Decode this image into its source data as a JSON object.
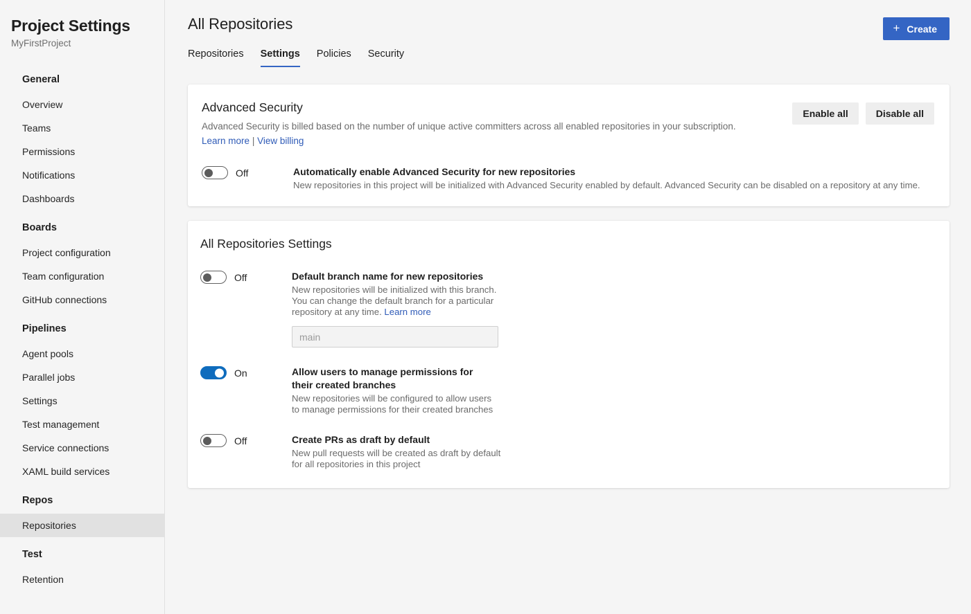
{
  "sidebar": {
    "title": "Project Settings",
    "subtitle": "MyFirstProject",
    "groups": [
      {
        "label": "General",
        "items": [
          "Overview",
          "Teams",
          "Permissions",
          "Notifications",
          "Dashboards"
        ]
      },
      {
        "label": "Boards",
        "items": [
          "Project configuration",
          "Team configuration",
          "GitHub connections"
        ]
      },
      {
        "label": "Pipelines",
        "items": [
          "Agent pools",
          "Parallel jobs",
          "Settings",
          "Test management",
          "Service connections",
          "XAML build services"
        ]
      },
      {
        "label": "Repos",
        "items": [
          "Repositories"
        ]
      },
      {
        "label": "Test",
        "items": [
          "Retention"
        ]
      }
    ],
    "selected_item": "Repositories"
  },
  "header": {
    "title": "All Repositories",
    "create_button": {
      "label": "Create",
      "icon": "plus-icon"
    },
    "tabs": [
      {
        "label": "Repositories",
        "active": false
      },
      {
        "label": "Settings",
        "active": true
      },
      {
        "label": "Policies",
        "active": false
      },
      {
        "label": "Security",
        "active": false
      }
    ]
  },
  "advanced_security": {
    "heading": "Advanced Security",
    "description": "Advanced Security is billed based on the number of unique active committers across all enabled repositories in your subscription.",
    "link_learn_more": "Learn more",
    "link_separator": "|",
    "link_view_billing": "View billing",
    "enable_all_label": "Enable all",
    "disable_all_label": "Disable all",
    "setting": {
      "toggle_state": "Off",
      "toggle_on": false,
      "title": "Automatically enable Advanced Security for new repositories",
      "description": "New repositories in this project will be initialized with Advanced Security enabled by default. Advanced Security can be disabled on a repository at any time."
    }
  },
  "all_repositories_settings": {
    "heading": "All Repositories Settings",
    "settings": [
      {
        "toggle_state": "Off",
        "toggle_on": false,
        "title": "Default branch name for new repositories",
        "description": "New repositories will be initialized with this branch. You can change the default branch for a particular repository at any time.",
        "inline_link": "Learn more",
        "input_placeholder": "main",
        "input_value": ""
      },
      {
        "toggle_state": "On",
        "toggle_on": true,
        "title": "Allow users to manage permissions for their created branches",
        "description": "New repositories will be configured to allow users to manage permissions for their created branches"
      },
      {
        "toggle_state": "Off",
        "toggle_on": false,
        "title": "Create PRs as draft by default",
        "description": "New pull requests will be created as draft by default for all repositories in this project"
      }
    ]
  },
  "colors": {
    "accent_blue": "#3465c4",
    "toggle_on_blue": "#0f6cbd",
    "link_blue": "#2f5bb7",
    "page_background": "#f5f5f5",
    "card_background": "#ffffff",
    "selected_item_background": "#e1e1e1"
  }
}
